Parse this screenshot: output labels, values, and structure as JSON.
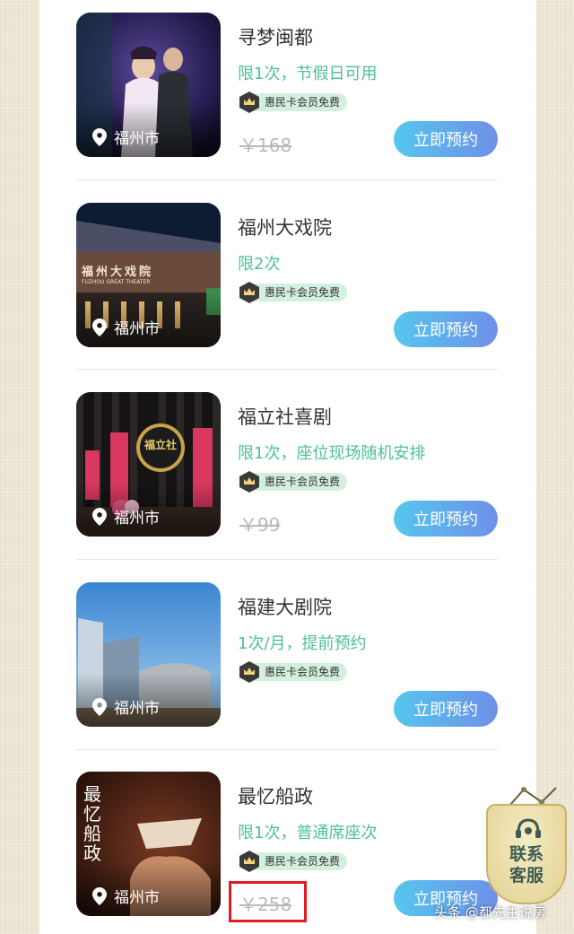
{
  "venues": [
    {
      "title": "寻梦闽都",
      "limit": "限1次，节假日可用",
      "badge": "惠民卡会员免费",
      "location": "福州市",
      "price": "￥168",
      "button": "立即预约"
    },
    {
      "title": "福州大戏院",
      "limit": "限2次",
      "badge": "惠民卡会员免费",
      "location": "福州市",
      "button": "立即预约",
      "image_text": "福州大戏院",
      "image_subtext": "FUZHOU GREAT THEATER"
    },
    {
      "title": "福立社喜剧",
      "limit": "限1次，座位现场随机安排",
      "badge": "惠民卡会员免费",
      "location": "福州市",
      "price": "￥99",
      "button": "立即预约",
      "image_text": "福立社"
    },
    {
      "title": "福建大剧院",
      "limit": "1次/月，提前预约",
      "badge": "惠民卡会员免费",
      "location": "福州市",
      "button": "立即预约"
    },
    {
      "title": "最忆船政",
      "limit": "限1次，普通席座次",
      "badge": "惠民卡会员免费",
      "location": "福州市",
      "price": "￥258",
      "button": "立即预约",
      "image_text": "最忆船政"
    }
  ],
  "service": {
    "label": "联系\n客服"
  },
  "watermark": "头条 @都先生说房",
  "colors": {
    "accent_green": "#4dbf9a",
    "button_start": "#55c7ee",
    "button_end": "#6f8fe8",
    "badge_bg": "#d3f0df",
    "highlight_red": "#e01b22"
  }
}
